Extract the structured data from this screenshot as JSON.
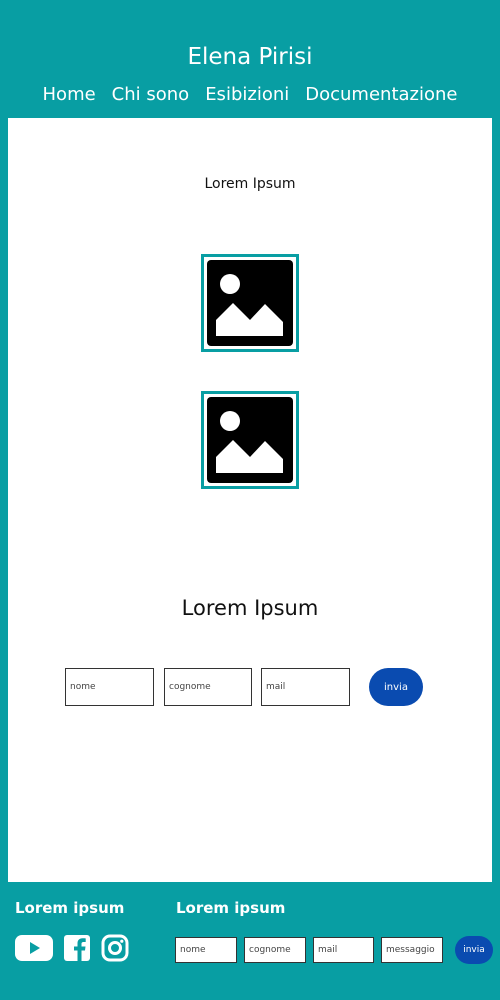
{
  "header": {
    "title": "Elena Pirisi",
    "nav": [
      "Home",
      "Chi sono",
      "Esibizioni",
      "Documentazione"
    ]
  },
  "main": {
    "intro_text": "Lorem Ipsum",
    "section_title": "Lorem Ipsum",
    "form": {
      "nome_placeholder": "nome",
      "cognome_placeholder": "cognome",
      "mail_placeholder": "mail",
      "submit_label": "invia"
    }
  },
  "footer": {
    "social_heading": "Lorem ipsum",
    "form_heading": "Lorem ipsum",
    "social_icons": [
      "youtube-icon",
      "facebook-icon",
      "instagram-icon"
    ],
    "form": {
      "nome_placeholder": "nome",
      "cognome_placeholder": "cognome",
      "mail_placeholder": "mail",
      "messaggio_placeholder": "messaggio",
      "submit_label": "invia"
    }
  },
  "colors": {
    "brand": "#089ea3",
    "button": "#0a4bb0",
    "background": "#ffffff"
  }
}
